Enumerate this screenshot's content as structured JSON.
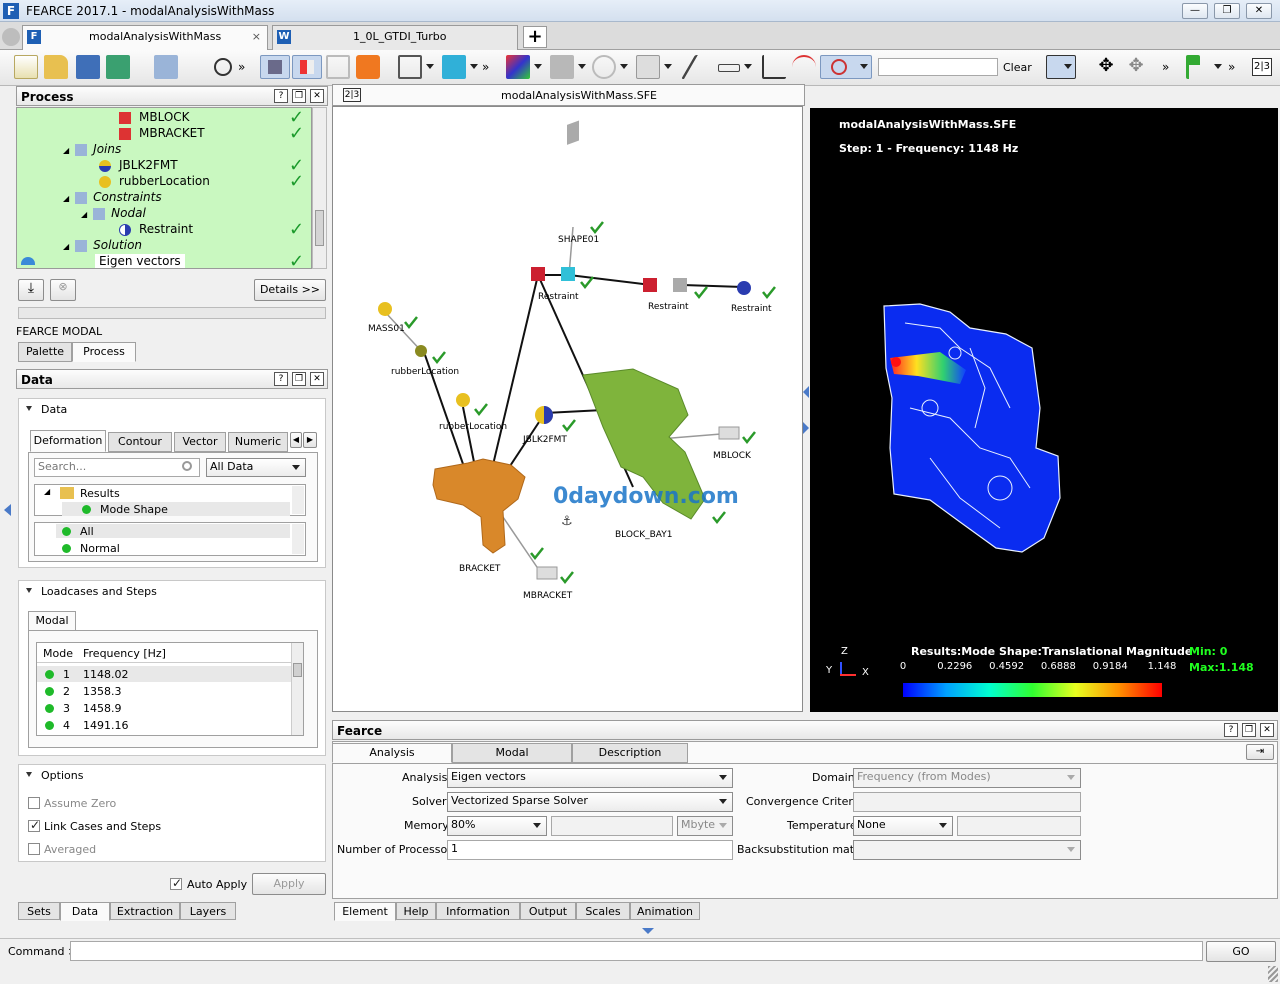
{
  "app": {
    "title": "FEARCE 2017.1 - modalAnalysisWithMass"
  },
  "doc_tabs": [
    {
      "label": "modalAnalysisWithMass"
    },
    {
      "label": "1_0L_GTDI_Turbo"
    }
  ],
  "toolbar": {
    "clear_label": "Clear",
    "search_value": ""
  },
  "process_panel": {
    "title": "Process",
    "tree": [
      {
        "label": "MBLOCK"
      },
      {
        "label": "MBRACKET"
      },
      {
        "label": "Joins"
      },
      {
        "label": "JBLK2FMT"
      },
      {
        "label": "rubberLocation"
      },
      {
        "label": "Constraints"
      },
      {
        "label": "Nodal"
      },
      {
        "label": "Restraint"
      },
      {
        "label": "Solution"
      },
      {
        "label": "Eigen vectors"
      }
    ],
    "details_label": "Details >>",
    "module_label": "FEARCE MODAL",
    "tabs": [
      "Palette",
      "Process"
    ]
  },
  "data_panel": {
    "title": "Data",
    "section_data": "Data",
    "tabs": [
      "Deformation",
      "Contour",
      "Vector",
      "Numeric"
    ],
    "search_placeholder": "Search...",
    "filter_value": "All Data",
    "results_tree": [
      "Results",
      "Mode Shape"
    ],
    "filter_list": [
      "All",
      "Normal"
    ],
    "loadcases_title": "Loadcases and Steps",
    "modal_tab": "Modal",
    "table_headers": [
      "Mode",
      "Frequency [Hz]"
    ],
    "table_rows": [
      {
        "mode": "1",
        "freq": "1148.02"
      },
      {
        "mode": "2",
        "freq": "1358.3"
      },
      {
        "mode": "3",
        "freq": "1458.9"
      },
      {
        "mode": "4",
        "freq": "1491.16"
      }
    ],
    "options_title": "Options",
    "options": [
      {
        "label": "Assume Zero",
        "checked": false
      },
      {
        "label": "Link Cases and Steps",
        "checked": true
      },
      {
        "label": "Averaged",
        "checked": false
      }
    ],
    "auto_apply_label": "Auto Apply",
    "apply_label": "Apply",
    "bottom_tabs": [
      "Sets",
      "Data",
      "Extraction",
      "Layers"
    ]
  },
  "graph_view": {
    "title": "modalAnalysisWithMass.SFE",
    "nodes": [
      "SHAPE01",
      "Restraint",
      "Restraint",
      "Restraint",
      "MASS01",
      "rubberLocation",
      "rubberLocation",
      "JBLK2FMT",
      "MBLOCK",
      "BLOCK_BAY1",
      "BRACKET",
      "MBRACKET"
    ],
    "watermark": "0daydown.com"
  },
  "result_view": {
    "title": "modalAnalysisWithMass.SFE",
    "step": "Step: 1 - Frequency: 1148 Hz",
    "legend_title": "Results:Mode Shape:Translational Magnitude",
    "ticks": [
      "0",
      "0.2296",
      "0.4592",
      "0.6888",
      "0.9184",
      "1.148"
    ],
    "min_label": "Min: 0",
    "max_label": "Max:1.148",
    "axis": {
      "z": "Z",
      "y": "Y",
      "x": "X"
    }
  },
  "fearce_panel": {
    "title": "Fearce",
    "tabs": [
      "Analysis",
      "Modal",
      "Description"
    ],
    "fields": {
      "analysis_label": "Analysis",
      "analysis_value": "Eigen vectors",
      "solver_label": "Solver",
      "solver_value": "Vectorized Sparse Solver",
      "memory_label": "Memory",
      "memory_value": "80%",
      "memory_unit": "Mbyte",
      "processors_label": "Number of Processors",
      "processors_value": "1",
      "domain_label": "Domain",
      "domain_value": "Frequency (from Modes)",
      "convergence_label": "Convergence Criteria",
      "temperature_label": "Temperature",
      "temperature_value": "None",
      "backsub_label": "Backsubstitution matrix"
    },
    "bottom_tabs": [
      "Element",
      "Help",
      "Information",
      "Output",
      "Scales",
      "Animation"
    ]
  },
  "command": {
    "label": "Command >",
    "go_label": "GO"
  },
  "colors": {
    "tree_bg": "#c9f8c0",
    "check": "#1b9a2b",
    "mesh_green": "#7fb43c",
    "bracket_orange": "#d9882a"
  }
}
